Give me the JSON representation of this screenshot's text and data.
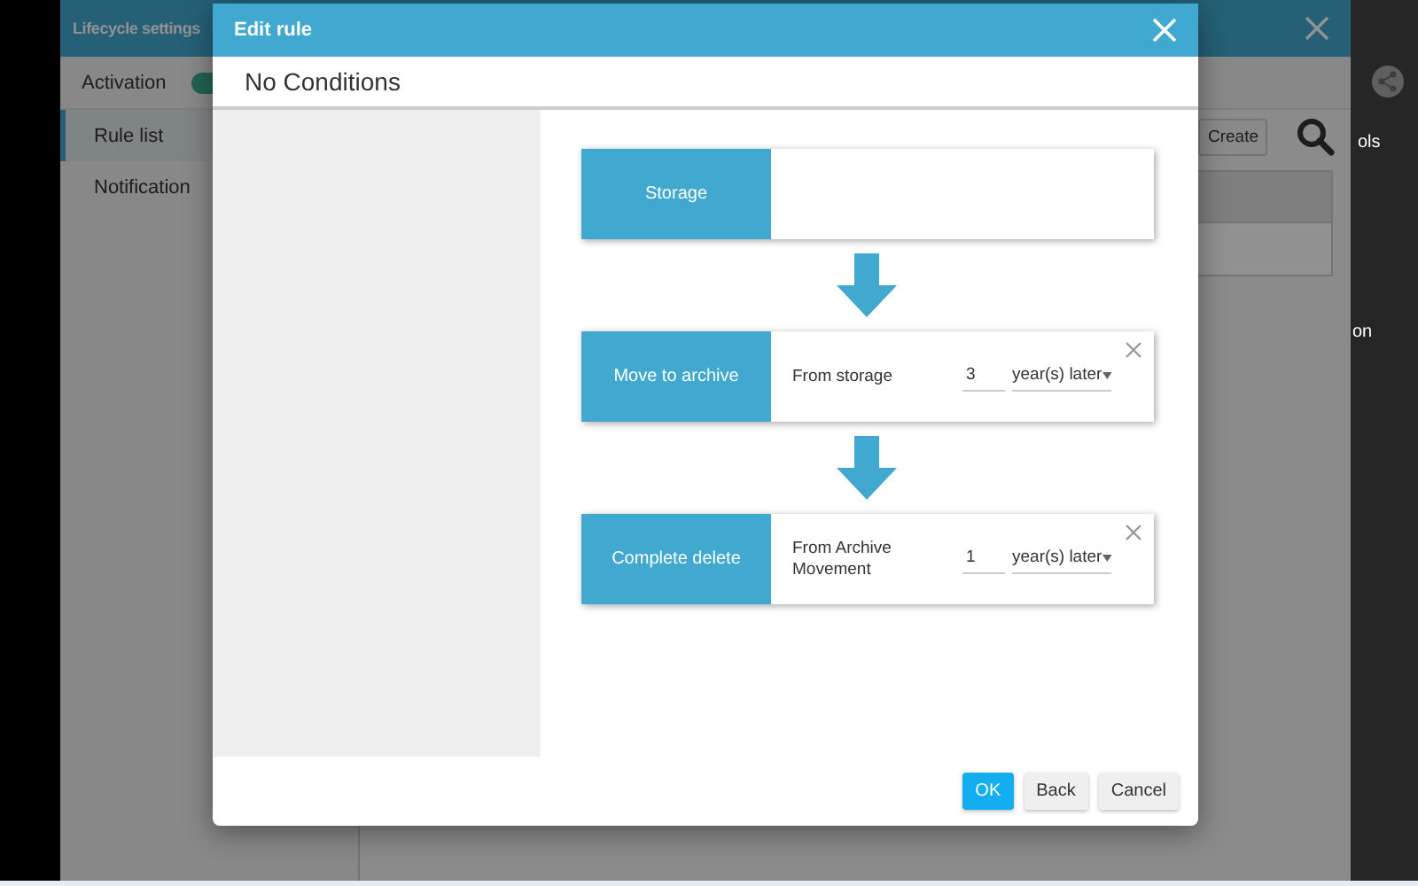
{
  "background_panel": {
    "title": "Lifecycle settings",
    "activation": {
      "label": "Activation",
      "on": true
    },
    "sidebar": {
      "items": [
        {
          "label": "Rule list",
          "selected": true
        },
        {
          "label": "Notification",
          "selected": false
        }
      ]
    },
    "create_button": "Create",
    "column_fragments": [
      "ols",
      "on"
    ]
  },
  "dialog": {
    "title": "Edit rule",
    "condition_title": "No Conditions",
    "steps": [
      {
        "kind": "start",
        "label": "Storage"
      },
      {
        "kind": "action",
        "label": "Move to archive",
        "source": "From storage",
        "amount": "3",
        "unit": "year(s) later"
      },
      {
        "kind": "action",
        "label": "Complete delete",
        "source": "From Archive Movement",
        "amount": "1",
        "unit": "year(s) later"
      }
    ],
    "buttons": [
      {
        "label": "OK",
        "kind": "primary"
      },
      {
        "label": "Back",
        "kind": "secondary"
      },
      {
        "label": "Cancel",
        "kind": "secondary"
      }
    ]
  }
}
